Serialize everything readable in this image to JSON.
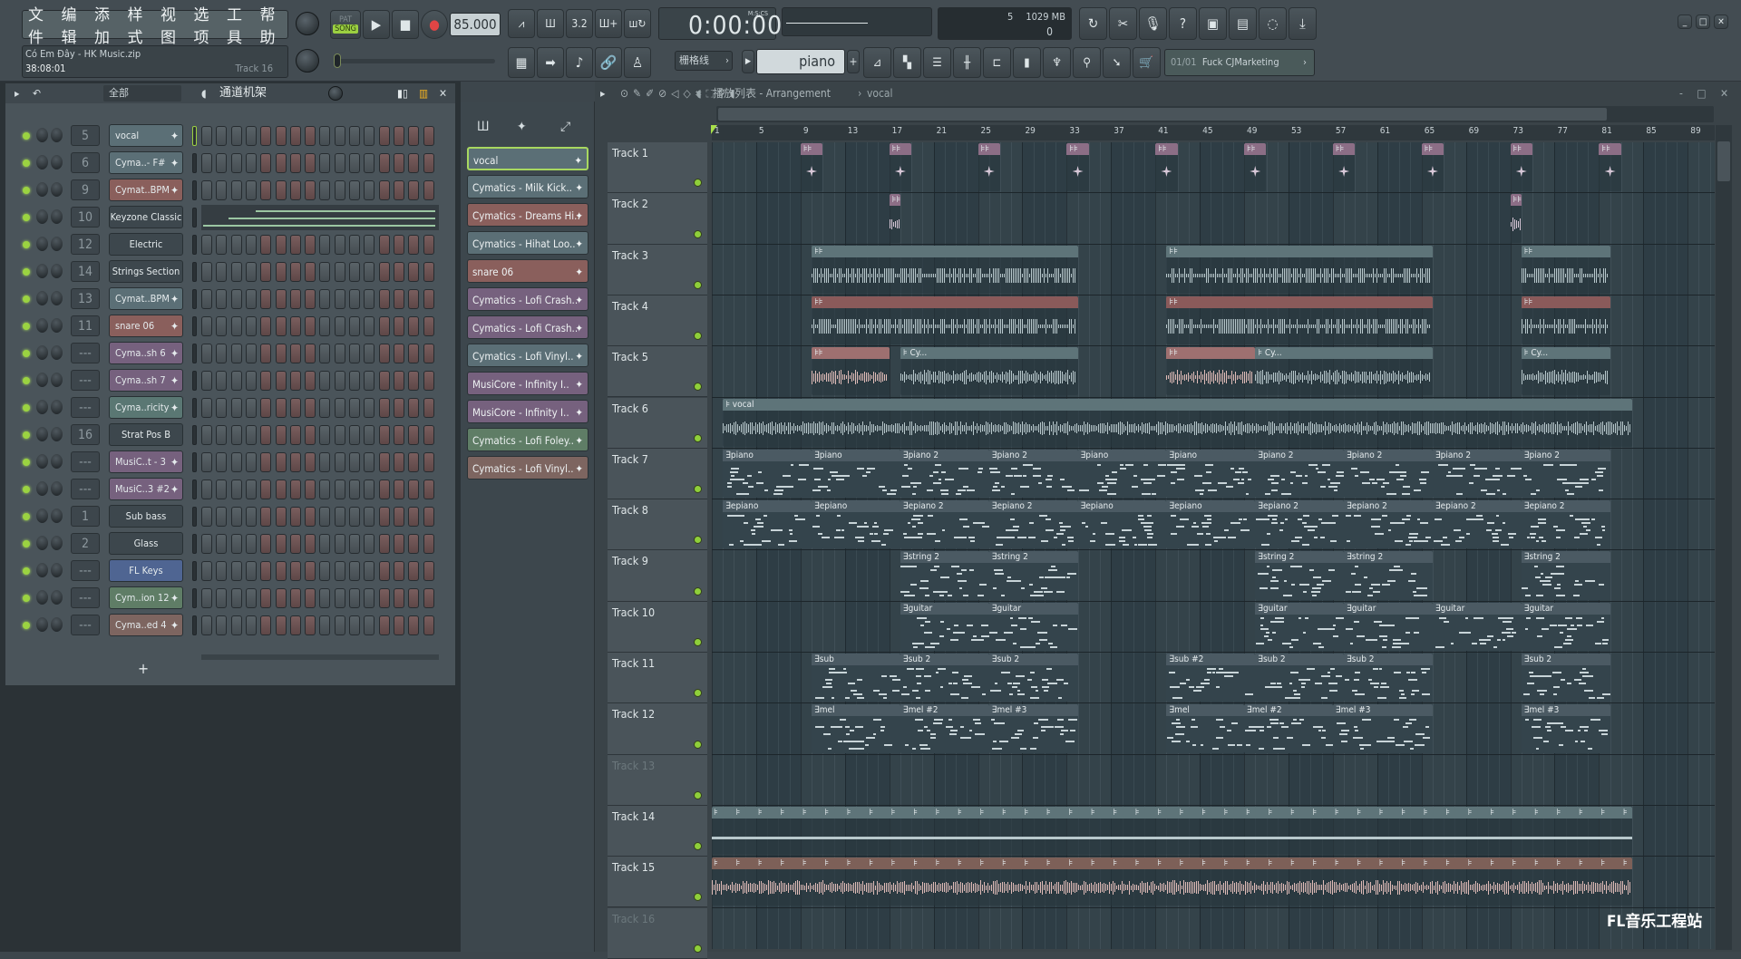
{
  "menu": {
    "items": [
      "文件",
      "编辑",
      "添加",
      "样式",
      "视图",
      "选项",
      "工具",
      "帮助"
    ]
  },
  "transport": {
    "pat_label": "PAT",
    "song_label": "SONG",
    "tempo": "85.000",
    "time": "0:00:00",
    "time_format": "M:S:CS"
  },
  "song_info": {
    "title": "Có Em Đây - HK Music.zip",
    "time": "38:08:01",
    "track": "Track 16"
  },
  "monitor": {
    "cpu": "5",
    "memory": "1029 MB",
    "polyphony": "0"
  },
  "snap": {
    "label": "栅格线"
  },
  "pattern_selector": {
    "value": "piano"
  },
  "news": {
    "counter": "01/01",
    "text": "Fuck CJMarketing"
  },
  "channel_rack": {
    "filter": "全部",
    "title": "通道机架",
    "add": "+",
    "channels": [
      {
        "num": "5",
        "name": "vocal",
        "color": "#5b6f76",
        "sample": true
      },
      {
        "num": "6",
        "name": "Cyma..- F#",
        "color": "#5b6f76",
        "sample": true
      },
      {
        "num": "9",
        "name": "Cymat..BPM",
        "color": "#8a5f5c",
        "sample": true
      },
      {
        "num": "10",
        "name": "Keyzone Classic",
        "color": "#3d474d",
        "sample": false,
        "pianoroll": true
      },
      {
        "num": "12",
        "name": "Electric",
        "color": "#3d474d",
        "sample": false
      },
      {
        "num": "14",
        "name": "Strings Section",
        "color": "#3d474d",
        "sample": false
      },
      {
        "num": "13",
        "name": "Cymat..BPM",
        "color": "#5b6f76",
        "sample": true
      },
      {
        "num": "11",
        "name": "snare 06",
        "color": "#8a5f5c",
        "sample": true
      },
      {
        "num": "---",
        "name": "Cyma..sh 6",
        "color": "#76617e",
        "sample": true
      },
      {
        "num": "---",
        "name": "Cyma..sh 7",
        "color": "#76617e",
        "sample": true
      },
      {
        "num": "---",
        "name": "Cyma..ricity",
        "color": "#5a7773",
        "sample": true
      },
      {
        "num": "16",
        "name": "Strat Pos B",
        "color": "#3d474d",
        "sample": false
      },
      {
        "num": "---",
        "name": "MusiC..t - 3",
        "color": "#76617e",
        "sample": true
      },
      {
        "num": "---",
        "name": "MusiC..3 #2",
        "color": "#76617e",
        "sample": true
      },
      {
        "num": "1",
        "name": "Sub bass",
        "color": "#3d474d",
        "sample": false
      },
      {
        "num": "2",
        "name": "Glass",
        "color": "#3d474d",
        "sample": false
      },
      {
        "num": "---",
        "name": "FL Keys",
        "color": "#4f6592",
        "sample": false
      },
      {
        "num": "---",
        "name": "Cym..ion 12",
        "color": "#5f7d66",
        "sample": true
      },
      {
        "num": "---",
        "name": "Cyma..ed 4",
        "color": "#7d6560",
        "sample": true
      }
    ]
  },
  "pattern_list": [
    {
      "name": "vocal",
      "color": "#5b6f76",
      "selected": true
    },
    {
      "name": "Cymatics - Milk Kick..",
      "color": "#5b6f76"
    },
    {
      "name": "Cymatics - Dreams Hi..",
      "color": "#8a5f5c"
    },
    {
      "name": "Cymatics - Hihat Loo..",
      "color": "#5b6f76"
    },
    {
      "name": "snare 06",
      "color": "#8a5f5c"
    },
    {
      "name": "Cymatics - Lofi Crash..",
      "color": "#76617e"
    },
    {
      "name": "Cymatics - Lofi Crash..",
      "color": "#76617e"
    },
    {
      "name": "Cymatics - Lofi Vinyl..",
      "color": "#5b6f76"
    },
    {
      "name": "MusiCore - Infinity I..",
      "color": "#76617e"
    },
    {
      "name": "MusiCore - Infinity I..",
      "color": "#76617e"
    },
    {
      "name": "Cymatics - Lofi Foley..",
      "color": "#5f7d66"
    },
    {
      "name": "Cymatics - Lofi Vinyl..",
      "color": "#7d6560"
    }
  ],
  "playlist": {
    "title": "播放列表 - Arrangement",
    "breadcrumb": "vocal",
    "bar_labels": [
      "1",
      "5",
      "9",
      "13",
      "17",
      "21",
      "25",
      "29",
      "33",
      "37",
      "41",
      "45",
      "49",
      "53",
      "57",
      "61",
      "65",
      "69",
      "73",
      "77",
      "81",
      "85",
      "89"
    ],
    "watermark": "FL音乐工程站",
    "tracks": [
      {
        "name": "Track 1",
        "clips": [
          {
            "s": 9,
            "e": 11,
            "type": "audio",
            "color": "#8c6e86"
          },
          {
            "s": 17,
            "e": 19,
            "type": "audio",
            "color": "#8c6e86"
          },
          {
            "s": 25,
            "e": 27,
            "type": "audio",
            "color": "#8c6e86"
          },
          {
            "s": 33,
            "e": 35,
            "type": "audio",
            "color": "#8c6e86"
          },
          {
            "s": 41,
            "e": 43,
            "type": "audio",
            "color": "#8c6e86"
          },
          {
            "s": 49,
            "e": 51,
            "type": "audio",
            "color": "#8c6e86"
          },
          {
            "s": 57,
            "e": 59,
            "type": "audio",
            "color": "#8c6e86"
          },
          {
            "s": 65,
            "e": 67,
            "type": "audio",
            "color": "#8c6e86"
          },
          {
            "s": 73,
            "e": 75,
            "type": "audio",
            "color": "#8c6e86"
          },
          {
            "s": 81,
            "e": 83,
            "type": "audio",
            "color": "#8c6e86"
          }
        ]
      },
      {
        "name": "Track 2",
        "clips": [
          {
            "s": 17,
            "e": 18,
            "type": "audio",
            "color": "#8c6e86"
          },
          {
            "s": 73,
            "e": 74,
            "type": "audio",
            "color": "#8c6e86"
          }
        ]
      },
      {
        "name": "Track 3",
        "clips": [
          {
            "s": 10,
            "e": 34,
            "type": "audio",
            "color": "#5e7479"
          },
          {
            "s": 42,
            "e": 66,
            "type": "audio",
            "color": "#5e7479"
          },
          {
            "s": 74,
            "e": 82,
            "type": "audio",
            "color": "#5e7479"
          }
        ]
      },
      {
        "name": "Track 4",
        "clips": [
          {
            "s": 10,
            "e": 34,
            "type": "audio",
            "color": "#8a5a5a"
          },
          {
            "s": 42,
            "e": 66,
            "type": "audio",
            "color": "#8a5a5a"
          },
          {
            "s": 74,
            "e": 82,
            "type": "audio",
            "color": "#8a5a5a"
          }
        ]
      },
      {
        "name": "Track 5",
        "clips": [
          {
            "s": 10,
            "e": 17,
            "type": "audio",
            "color": "#9e7070"
          },
          {
            "s": 18,
            "e": 34,
            "type": "audio",
            "color": "#5e7479",
            "label": "Cy..."
          },
          {
            "s": 42,
            "e": 50,
            "type": "audio",
            "color": "#9e7070"
          },
          {
            "s": 50,
            "e": 66,
            "type": "audio",
            "color": "#5e7479",
            "label": "Cy..."
          },
          {
            "s": 74,
            "e": 82,
            "type": "audio",
            "color": "#5e7479",
            "label": "Cy..."
          }
        ]
      },
      {
        "name": "Track 6",
        "clips": [
          {
            "s": 2,
            "e": 84,
            "type": "audio",
            "color": "#5e7479",
            "label": "vocal"
          }
        ]
      },
      {
        "name": "Track 7",
        "clips": [
          {
            "s": 2,
            "e": 10,
            "label": "piano"
          },
          {
            "s": 10,
            "e": 18,
            "label": "piano"
          },
          {
            "s": 18,
            "e": 26,
            "label": "piano 2"
          },
          {
            "s": 26,
            "e": 34,
            "label": "piano 2"
          },
          {
            "s": 34,
            "e": 42,
            "label": "piano"
          },
          {
            "s": 42,
            "e": 50,
            "label": "piano"
          },
          {
            "s": 50,
            "e": 58,
            "label": "piano 2"
          },
          {
            "s": 58,
            "e": 66,
            "label": "piano 2"
          },
          {
            "s": 66,
            "e": 74,
            "label": "piano 2"
          },
          {
            "s": 74,
            "e": 82,
            "label": "piano 2"
          }
        ]
      },
      {
        "name": "Track 8",
        "clips": [
          {
            "s": 2,
            "e": 10,
            "label": "epiano"
          },
          {
            "s": 10,
            "e": 18,
            "label": "epiano"
          },
          {
            "s": 18,
            "e": 26,
            "label": "epiano 2"
          },
          {
            "s": 26,
            "e": 34,
            "label": "epiano 2"
          },
          {
            "s": 34,
            "e": 42,
            "label": "epiano"
          },
          {
            "s": 42,
            "e": 50,
            "label": "epiano"
          },
          {
            "s": 50,
            "e": 58,
            "label": "epiano 2"
          },
          {
            "s": 58,
            "e": 66,
            "label": "epiano 2"
          },
          {
            "s": 66,
            "e": 74,
            "label": "epiano 2"
          },
          {
            "s": 74,
            "e": 82,
            "label": "epiano 2"
          }
        ]
      },
      {
        "name": "Track 9",
        "clips": [
          {
            "s": 18,
            "e": 26,
            "label": "string 2"
          },
          {
            "s": 26,
            "e": 34,
            "label": "string 2"
          },
          {
            "s": 50,
            "e": 58,
            "label": "string 2"
          },
          {
            "s": 58,
            "e": 66,
            "label": "string 2"
          },
          {
            "s": 74,
            "e": 82,
            "label": "string 2"
          }
        ]
      },
      {
        "name": "Track 10",
        "clips": [
          {
            "s": 18,
            "e": 26,
            "label": "guitar"
          },
          {
            "s": 26,
            "e": 34,
            "label": "guitar"
          },
          {
            "s": 50,
            "e": 58,
            "label": "guitar"
          },
          {
            "s": 58,
            "e": 66,
            "label": "guitar"
          },
          {
            "s": 66,
            "e": 74,
            "label": "guitar"
          },
          {
            "s": 74,
            "e": 82,
            "label": "guitar"
          }
        ]
      },
      {
        "name": "Track 11",
        "clips": [
          {
            "s": 10,
            "e": 18,
            "label": "sub"
          },
          {
            "s": 18,
            "e": 26,
            "label": "sub 2"
          },
          {
            "s": 26,
            "e": 34,
            "label": "sub 2"
          },
          {
            "s": 42,
            "e": 50,
            "label": "sub #2"
          },
          {
            "s": 50,
            "e": 58,
            "label": "sub 2"
          },
          {
            "s": 58,
            "e": 66,
            "label": "sub 2"
          },
          {
            "s": 74,
            "e": 82,
            "label": "sub 2"
          }
        ]
      },
      {
        "name": "Track 12",
        "clips": [
          {
            "s": 10,
            "e": 18,
            "label": "mel"
          },
          {
            "s": 18,
            "e": 26,
            "label": "mel #2"
          },
          {
            "s": 26,
            "e": 34,
            "label": "mel #3"
          },
          {
            "s": 42,
            "e": 49,
            "label": "mel"
          },
          {
            "s": 49,
            "e": 57,
            "label": "mel #2"
          },
          {
            "s": 57,
            "e": 66,
            "label": "mel #3"
          },
          {
            "s": 74,
            "e": 82,
            "label": "mel #3"
          }
        ]
      },
      {
        "name": "Track 13",
        "dim": true,
        "clips": []
      },
      {
        "name": "Track 14",
        "clips": [
          {
            "s": 1,
            "e": 84,
            "type": "audio",
            "color": "#5e7479",
            "repeat": 2
          }
        ]
      },
      {
        "name": "Track 15",
        "clips": [
          {
            "s": 1,
            "e": 84,
            "type": "audio",
            "color": "#7d6058",
            "repeat": 2
          }
        ]
      },
      {
        "name": "Track 16",
        "dim": true,
        "clips": []
      }
    ]
  }
}
